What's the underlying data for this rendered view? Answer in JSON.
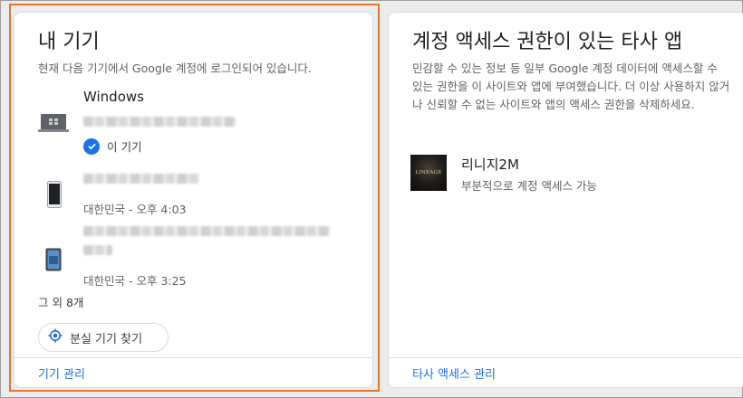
{
  "devices_card": {
    "title": "내 기기",
    "description": "현재 다음 기기에서 Google 계정에 로그인되어 있습니다.",
    "devices": [
      {
        "name": "Windows",
        "icon": "laptop-icon",
        "this_device_label": "이 기기"
      },
      {
        "icon": "phone-icon",
        "meta": "대한민국 - 오후 4:03"
      },
      {
        "icon": "tablet-icon",
        "meta": "대한민국 - 오후 3:25"
      }
    ],
    "more_devices": "그 외 8개",
    "find_device_label": "분실 기기 찾기",
    "manage_link": "기기 관리"
  },
  "apps_card": {
    "title": "계정 액세스 권한이 있는 타사 앱",
    "description": "민감할 수 있는 정보 등 일부 Google 계정 데이터에 액세스할 수 있는 권한을 이 사이트와 앱에 부여했습니다. 더 이상 사용하지 않거나 신뢰할 수 없는 사이트와 앱의 액세스 권한을 삭제하세요.",
    "apps": [
      {
        "name": "리니지2M",
        "access": "부분적으로 계정 액세스 가능",
        "logo_text": "LINEAGE"
      }
    ],
    "manage_link": "타사 액세스 관리"
  },
  "colors": {
    "accent": "#1a73e8",
    "highlight": "#e8742e"
  }
}
